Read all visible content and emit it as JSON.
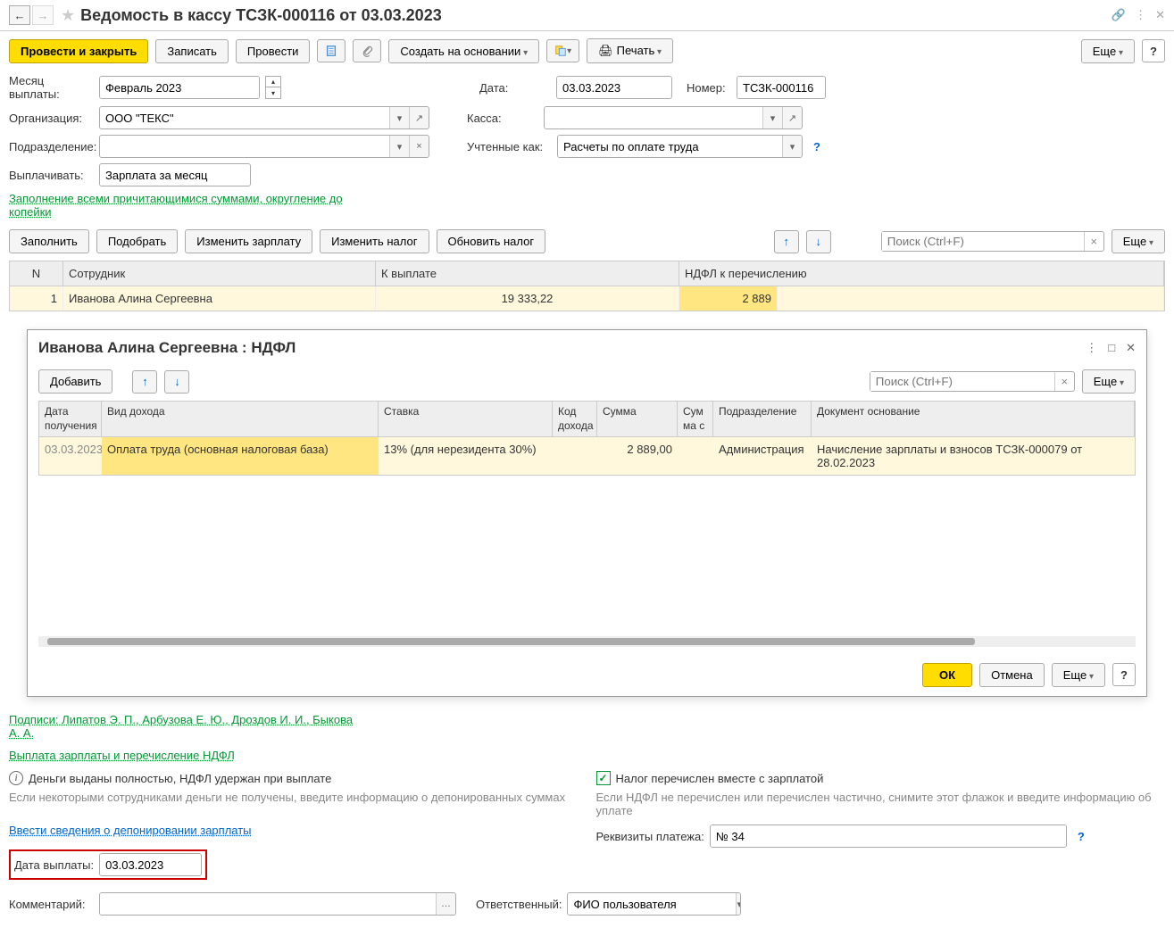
{
  "title": "Ведомость в кассу ТСЗК-000116 от 03.03.2023",
  "toolbar": {
    "post_close": "Провести и закрыть",
    "save": "Записать",
    "post": "Провести",
    "create_based": "Создать на основании",
    "print": "Печать",
    "more": "Еще"
  },
  "form": {
    "month_label": "Месяц выплаты:",
    "month_value": "Февраль 2023",
    "date_label": "Дата:",
    "date_value": "03.03.2023",
    "number_label": "Номер:",
    "number_value": "ТСЗК-000116",
    "org_label": "Организация:",
    "org_value": "ООО \"ТЕКС\"",
    "cash_label": "Касса:",
    "cash_value": "",
    "dept_label": "Подразделение:",
    "dept_value": "",
    "accounted_label": "Учтенные как:",
    "accounted_value": "Расчеты по оплате труда",
    "pay_label": "Выплачивать:",
    "pay_value": "Зарплата за месяц",
    "fill_link": "Заполнение всеми причитающимися суммами, округление до копейки"
  },
  "actions": {
    "fill": "Заполнить",
    "pick": "Подобрать",
    "change_salary": "Изменить зарплату",
    "change_tax": "Изменить налог",
    "update_tax": "Обновить налог",
    "search_ph": "Поиск (Ctrl+F)",
    "more": "Еще"
  },
  "main_table": {
    "col_n": "N",
    "col_emp": "Сотрудник",
    "col_pay": "К выплате",
    "col_ndfl": "НДФЛ к перечислению",
    "rows": [
      {
        "n": "1",
        "emp": "Иванова Алина Сергеевна",
        "pay": "19 333,22",
        "ndfl": "2 889"
      }
    ]
  },
  "popup": {
    "title": "Иванова Алина Сергеевна : НДФЛ",
    "add": "Добавить",
    "search_ph": "Поиск (Ctrl+F)",
    "more": "Еще",
    "cols": {
      "date": "Дата получения",
      "kind": "Вид дохода",
      "rate": "Ставка",
      "code": "Код дохода",
      "sum": "Сумма",
      "sum_s": "Сум ма с",
      "dept": "Подразделение",
      "doc": "Документ основание"
    },
    "rows": [
      {
        "date": "03.03.2023",
        "kind": "Оплата труда (основная налоговая база)",
        "rate": "13% (для нерезидента 30%)",
        "code": "",
        "sum": "2 889,00",
        "sum_s": "",
        "dept": "Администрация",
        "doc": "Начисление зарплаты и взносов ТСЗК-000079 от 28.02.2023"
      }
    ],
    "ok": "ОК",
    "cancel": "Отмена",
    "more2": "Еще",
    "help": "?"
  },
  "bottom": {
    "signatures": "Подписи: Липатов Э. П., Арбузова Е. Ю., Дроздов И. И., Быкова А. А.",
    "payout_link": "Выплата зарплаты и перечисление НДФЛ",
    "info_text": "Деньги выданы полностью, НДФЛ удержан при выплате",
    "checkbox_text": "Налог перечислен вместе с зарплатой",
    "hint_left": "Если некоторыми сотрудниками деньги не получены, введите информацию о депонированных суммах",
    "hint_right": "Если НДФЛ не перечислен или перечислен частично, снимите этот флажок и введите информацию об уплате",
    "deposit_link": "Ввести сведения о депонировании зарплаты",
    "requisites_label": "Реквизиты платежа:",
    "requisites_value": "№ 34",
    "pay_date_label": "Дата выплаты:",
    "pay_date_value": "03.03.2023",
    "comment_label": "Комментарий:",
    "comment_value": "",
    "responsible_label": "Ответственный:",
    "responsible_value": "ФИО пользователя"
  }
}
